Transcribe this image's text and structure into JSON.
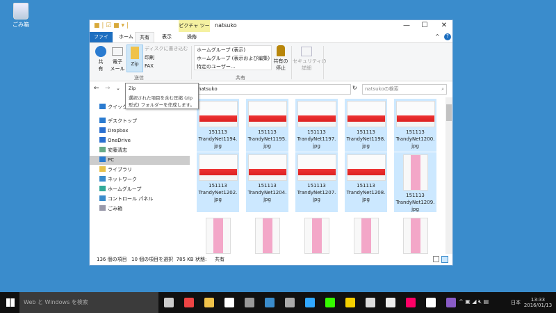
{
  "desktop": {
    "recycle_bin": "ごみ箱"
  },
  "window": {
    "title": "natsuko",
    "context_tab": "ピクチャ ツール",
    "context_subtab": "操作",
    "tabs": [
      "ファイル",
      "ホーム",
      "共有",
      "表示"
    ],
    "ribbon": {
      "share": "共\n有",
      "email": "電子\nメール",
      "zip": "Zip",
      "burn": "ディスクに書き込む",
      "print": "印刷",
      "fax": "FAX",
      "send_group": "送信",
      "homegroup_view": "ホームグループ (表示)",
      "homegroup_edit": "ホームグループ (表示および編集)",
      "specific_users": "特定のユーザー...",
      "share_group": "共有",
      "stop_sharing": "共有の\n停止",
      "security": "セキュリティの\n詳細"
    },
    "address": "natsuko",
    "search_placeholder": "natsukoの検索",
    "tooltip": {
      "title": "Zip",
      "body": "選択された項目を含む圧縮 (zip 形式) フォルダーを作成します。"
    },
    "nav": [
      "クイック",
      "デスクトップ",
      "Dropbox",
      "OneDrive",
      "安藤清志",
      "PC",
      "ライブラリ",
      "ネットワーク",
      "ホームグループ",
      "コントロール パネル",
      "ごみ箱"
    ],
    "files": [
      {
        "line1": "151113",
        "line2": "TrandyNet1194.",
        "line3": "jpg",
        "selected": true,
        "orientation": "landscape"
      },
      {
        "line1": "151113",
        "line2": "TrandyNet1195.",
        "line3": "jpg",
        "selected": true,
        "orientation": "landscape"
      },
      {
        "line1": "151113",
        "line2": "TrandyNet1197.",
        "line3": "jpg",
        "selected": true,
        "orientation": "landscape"
      },
      {
        "line1": "151113",
        "line2": "TrandyNet1198.",
        "line3": "jpg",
        "selected": true,
        "orientation": "landscape"
      },
      {
        "line1": "151113",
        "line2": "TrandyNet1200.",
        "line3": "jpg",
        "selected": true,
        "orientation": "landscape"
      },
      {
        "line1": "151113",
        "line2": "TrandyNet1202.",
        "line3": "jpg",
        "selected": true,
        "orientation": "landscape"
      },
      {
        "line1": "151113",
        "line2": "TrandyNet1204.",
        "line3": "jpg",
        "selected": true,
        "orientation": "landscape"
      },
      {
        "line1": "151113",
        "line2": "TrandyNet1207.",
        "line3": "jpg",
        "selected": true,
        "orientation": "landscape"
      },
      {
        "line1": "151113",
        "line2": "TrandyNet1208.",
        "line3": "jpg",
        "selected": true,
        "orientation": "landscape"
      },
      {
        "line1": "151113",
        "line2": "TrandyNet1209.",
        "line3": "jpg",
        "selected": true,
        "orientation": "portrait"
      },
      {
        "line1": "",
        "line2": "",
        "line3": "",
        "selected": false,
        "orientation": "portrait"
      },
      {
        "line1": "",
        "line2": "",
        "line3": "",
        "selected": false,
        "orientation": "portrait"
      },
      {
        "line1": "",
        "line2": "",
        "line3": "",
        "selected": false,
        "orientation": "portrait"
      },
      {
        "line1": "",
        "line2": "",
        "line3": "",
        "selected": false,
        "orientation": "portrait"
      },
      {
        "line1": "",
        "line2": "",
        "line3": "",
        "selected": false,
        "orientation": "portrait"
      }
    ],
    "status": {
      "count": "136 個の項目",
      "selected": "10 個の項目を選択  785 KB",
      "state": "状態:",
      "state_value": "共有"
    }
  },
  "taskbar": {
    "search": "Web と Windows を検索",
    "lang": "日本",
    "time": "13:33",
    "date": "2016/01/13",
    "apps": [
      "task-view",
      "chrome",
      "explorer",
      "store",
      "app5",
      "thunderbird",
      "app7",
      "photoshop",
      "dreamweaver",
      "app10",
      "app11",
      "app12",
      "itunes",
      "notepad",
      "app15"
    ]
  }
}
